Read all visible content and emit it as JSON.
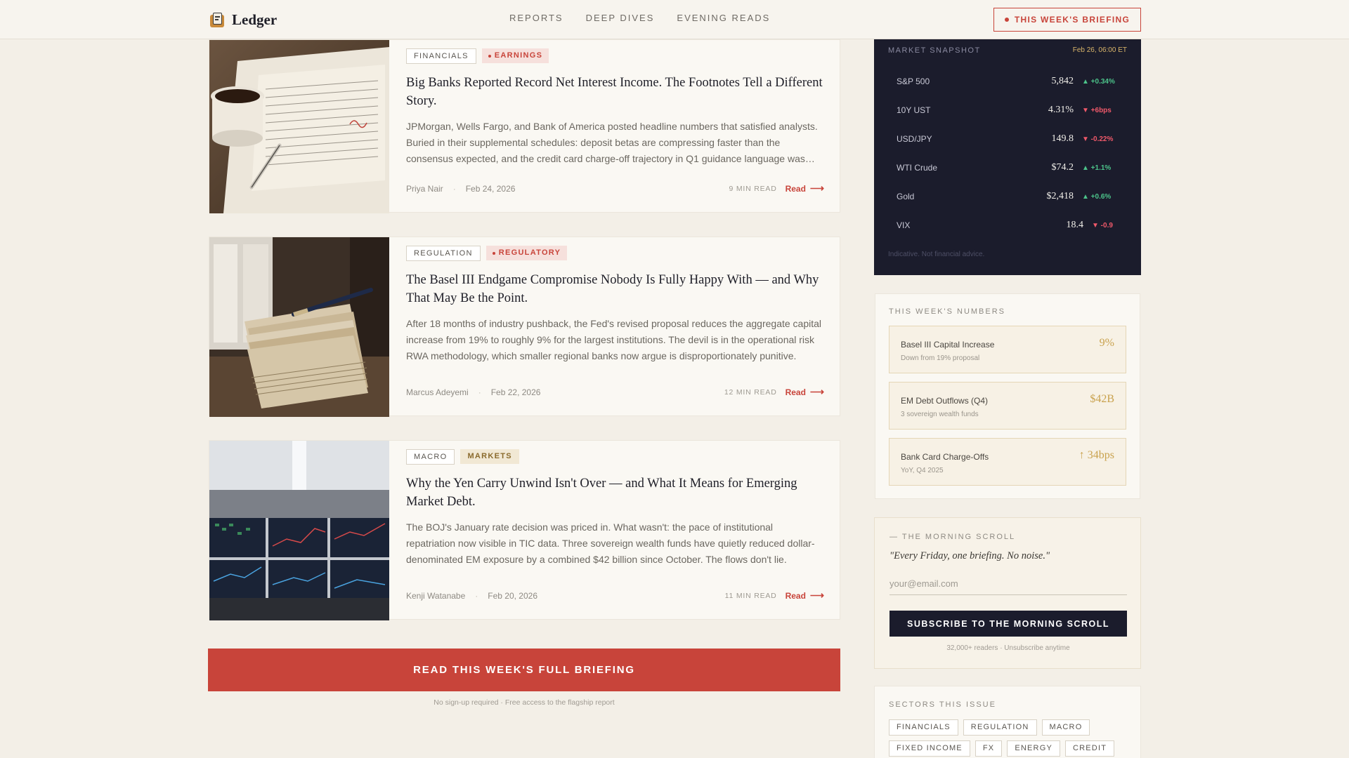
{
  "header": {
    "logo_text": "Ledger",
    "nav": [
      "REPORTS",
      "DEEP DIVES",
      "EVENING READS"
    ],
    "briefing_button": "THIS WEEK'S BRIEFING"
  },
  "articles": [
    {
      "tag": "FINANCIALS",
      "accent_tag": "EARNINGS",
      "title": "Big Banks Reported Record Net Interest Income. The Footnotes Tell a Different Story.",
      "description": "JPMorgan, Wells Fargo, and Bank of America posted headline numbers that satisfied analysts. Buried in their supplemental schedules: deposit betas are compressing faster than the consensus expected, and the credit card charge-off trajectory in Q1 guidance language was…",
      "author": "Priya Nair",
      "date": "Feb 24, 2026",
      "read_time": "9 MIN READ",
      "read_label": "Read"
    },
    {
      "tag": "REGULATION",
      "accent_tag": "REGULATORY",
      "title": "The Basel III Endgame Compromise Nobody Is Fully Happy With — and Why That May Be the Point.",
      "description": "After 18 months of industry pushback, the Fed's revised proposal reduces the aggregate capital increase from 19% to roughly 9% for the largest institutions. The devil is in the operational risk RWA methodology, which smaller regional banks now argue is disproportionately punitive.",
      "author": "Marcus Adeyemi",
      "date": "Feb 22, 2026",
      "read_time": "12 MIN READ",
      "read_label": "Read"
    },
    {
      "tag": "MACRO",
      "accent_tag": "MARKETS",
      "title": "Why the Yen Carry Unwind Isn't Over — and What It Means for Emerging Market Debt.",
      "description": "The BOJ's January rate decision was priced in. What wasn't: the pace of institutional repatriation now visible in TIC data. Three sovereign wealth funds have quietly reduced dollar-denominated EM exposure by a combined $42 billion since October. The flows don't lie.",
      "author": "Kenji Watanabe",
      "date": "Feb 20, 2026",
      "read_time": "11 MIN READ",
      "read_label": "Read"
    }
  ],
  "cta": {
    "label": "READ THIS WEEK'S FULL BRIEFING",
    "sub": "No sign-up required · Free access to the flagship report"
  },
  "snapshot": {
    "title": "MARKET SNAPSHOT",
    "timestamp": "Feb 26, 06:00 ET",
    "rows": [
      {
        "name": "S&P 500",
        "value": "5,842",
        "change": "▲ +0.34%",
        "direction": "up"
      },
      {
        "name": "10Y UST",
        "value": "4.31%",
        "change": "▼ +6bps",
        "direction": "down"
      },
      {
        "name": "USD/JPY",
        "value": "149.8",
        "change": "▼ -0.22%",
        "direction": "down"
      },
      {
        "name": "WTI Crude",
        "value": "$74.2",
        "change": "▲ +1.1%",
        "direction": "up"
      },
      {
        "name": "Gold",
        "value": "$2,418",
        "change": "▲ +0.6%",
        "direction": "up"
      },
      {
        "name": "VIX",
        "value": "18.4",
        "change": "▼ -0.9",
        "direction": "down"
      }
    ],
    "footnote": "Indicative. Not financial advice.",
    "colors": {
      "up": "#4cc38a",
      "down": "#f0596a"
    }
  },
  "numbers": {
    "label": "THIS WEEK'S NUMBERS",
    "items": [
      {
        "name": "Basel III Capital Increase",
        "sub": "Down from 19% proposal",
        "value": "9%"
      },
      {
        "name": "EM Debt Outflows (Q4)",
        "sub": "3 sovereign wealth funds",
        "value": "$42B"
      },
      {
        "name": "Bank Card Charge-Offs",
        "sub": "YoY, Q4 2025",
        "value": "↑ 34bps"
      }
    ]
  },
  "newsletter": {
    "label": "— THE MORNING SCROLL",
    "quote": "\"Every Friday, one briefing. No noise.\"",
    "placeholder": "your@email.com",
    "button": "SUBSCRIBE TO THE MORNING SCROLL",
    "footnote": "32,000+ readers · Unsubscribe anytime"
  },
  "sectors": {
    "label": "SECTORS THIS ISSUE",
    "chips": [
      "FINANCIALS",
      "REGULATION",
      "MACRO",
      "FIXED INCOME",
      "FX",
      "ENERGY",
      "CREDIT"
    ]
  },
  "theme": {
    "accent": "#c8443a",
    "navy": "#1b1c2c",
    "gold": "#c9a24e",
    "background": "#f3efe7"
  }
}
